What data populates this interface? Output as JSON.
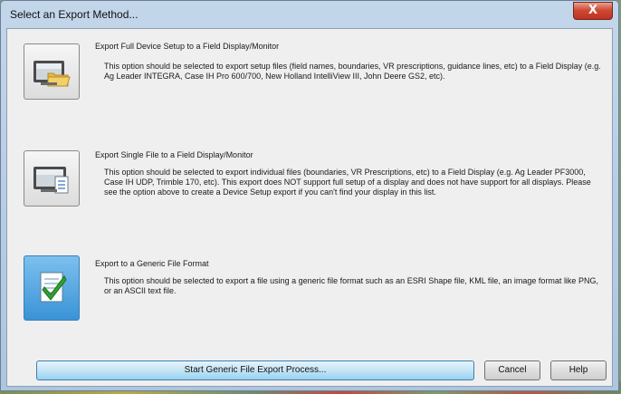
{
  "dialog": {
    "title": "Select an Export Method...",
    "close_label": "X"
  },
  "options": [
    {
      "title": "Export Full Device Setup to a Field Display/Monitor",
      "description": "This option should be selected to export setup files (field names, boundaries, VR prescriptions, guidance lines, etc) to a Field Display (e.g. Ag Leader INTEGRA, Case IH Pro 600/700, New Holland IntelliView III, John Deere GS2, etc).",
      "icon": "monitor-folder-icon",
      "selected": false
    },
    {
      "title": "Export Single File to a Field Display/Monitor",
      "description": "This option should be selected to export individual files (boundaries, VR Prescriptions, etc) to a Field Display (e.g. Ag Leader PF3000, Case IH UDP, Trimble 170, etc). This export does NOT support full setup of a display and does not have support for all displays. Please see the option above to create a Device Setup export if you can't find your display in this list.",
      "icon": "monitor-document-icon",
      "selected": false
    },
    {
      "title": "Export to a Generic File Format",
      "description": "This option should be selected to export a file using a generic file format such as an ESRI Shape file, KML file, an image format like PNG, or an ASCII text file.",
      "icon": "document-checkmark-icon",
      "selected": true
    }
  ],
  "buttons": {
    "start": "Start Generic File Export Process...",
    "cancel": "Cancel",
    "help": "Help"
  },
  "colors": {
    "selected_accent": "#3a93d6",
    "check_green": "#2fa12f",
    "close_red": "#c0311f"
  }
}
